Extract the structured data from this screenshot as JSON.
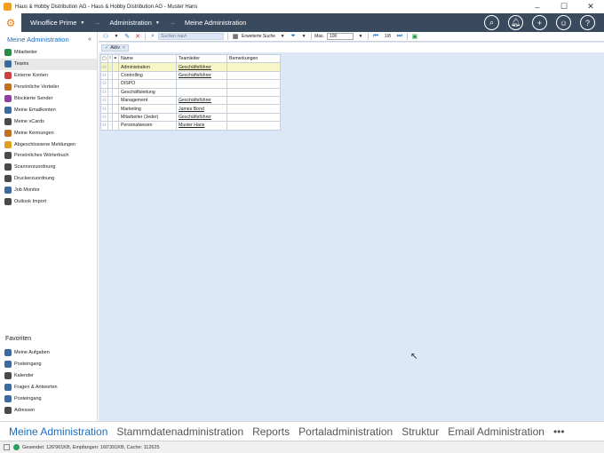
{
  "window": {
    "title": "Haus & Hobby Distribution AG - Haus & Hobby Distribution AG - Muster Hans",
    "controls": {
      "minimize": "–",
      "maximize": "☐",
      "close": "✕"
    }
  },
  "topnav": {
    "product": "Winoffice Prime",
    "section": "Administration",
    "page": "Meine Administration",
    "icons": [
      "search-icon",
      "bell-icon",
      "add-icon",
      "user-icon",
      "help-icon"
    ]
  },
  "sidebar": {
    "title": "Meine Administration",
    "collapse": "«",
    "items": [
      {
        "label": "Mitarbeiter",
        "color": "#2a8a4a"
      },
      {
        "label": "Teams",
        "color": "#3a6aa0"
      },
      {
        "label": "Externe Konten",
        "color": "#d04040"
      },
      {
        "label": "Persönliche Verteiler",
        "color": "#c07020"
      },
      {
        "label": "Blockierte Sender",
        "color": "#9040a0"
      },
      {
        "label": "Meine Emailkonten",
        "color": "#3a6aa0"
      },
      {
        "label": "Meine vCards",
        "color": "#4a4a4a"
      },
      {
        "label": "Meine Kennungen",
        "color": "#c07020"
      },
      {
        "label": "Abgeschlossene Meldungen",
        "color": "#e0a020"
      },
      {
        "label": "Persönliches Wörterbuch",
        "color": "#4a4a4a"
      },
      {
        "label": "Scannerzuordnung",
        "color": "#4a4a4a"
      },
      {
        "label": "Druckerzuordnung",
        "color": "#4a4a4a"
      },
      {
        "label": "Job Monitor",
        "color": "#3a6aa0"
      },
      {
        "label": "Outlook Import",
        "color": "#4a4a4a"
      }
    ],
    "favorites_title": "Favoriten",
    "favorites": [
      {
        "label": "Meine Aufgaben",
        "color": "#3a6aa0"
      },
      {
        "label": "Posteingang",
        "color": "#3a6aa0"
      },
      {
        "label": "Kalender",
        "color": "#4a4a4a"
      },
      {
        "label": "Fragen & Antworten",
        "color": "#3a6aa0"
      },
      {
        "label": "Posteingang",
        "color": "#3a6aa0"
      },
      {
        "label": "Adressen",
        "color": "#4a4a4a"
      }
    ]
  },
  "toolbar": {
    "search_placeholder": "Suchen nach",
    "extended_search": "Erweiterte Suche",
    "max_label": "Max.",
    "max_value": "100",
    "paging": "1/8"
  },
  "filter": {
    "chip": "Aktiv"
  },
  "grid": {
    "columns": [
      "Name",
      "Teamleiter",
      "Bemerkungen"
    ],
    "rows": [
      {
        "name": "Administration",
        "leader": "Geschäftsführer",
        "remarks": ""
      },
      {
        "name": "Controlling",
        "leader": "Geschäftsführer",
        "remarks": ""
      },
      {
        "name": "DISPO",
        "leader": "",
        "remarks": ""
      },
      {
        "name": "Geschäftsleitung",
        "leader": "",
        "remarks": ""
      },
      {
        "name": "Management",
        "leader": "Geschäftsführer",
        "remarks": ""
      },
      {
        "name": "Marketing",
        "leader": "James Bond",
        "remarks": ""
      },
      {
        "name": "Mitarbeiter (Jeder)",
        "leader": "Geschäftsführer",
        "remarks": ""
      },
      {
        "name": "Personalwesen",
        "leader": "Muster Hans",
        "remarks": ""
      }
    ]
  },
  "bottomtabs": [
    "Meine Administration",
    "Stammdatenadministration",
    "Reports",
    "Portaladministration",
    "Struktur",
    "Email Administration",
    "•••"
  ],
  "status": "Gesendet: 126'961KB, Empfangen: 160'391KB, Cache: 112625"
}
